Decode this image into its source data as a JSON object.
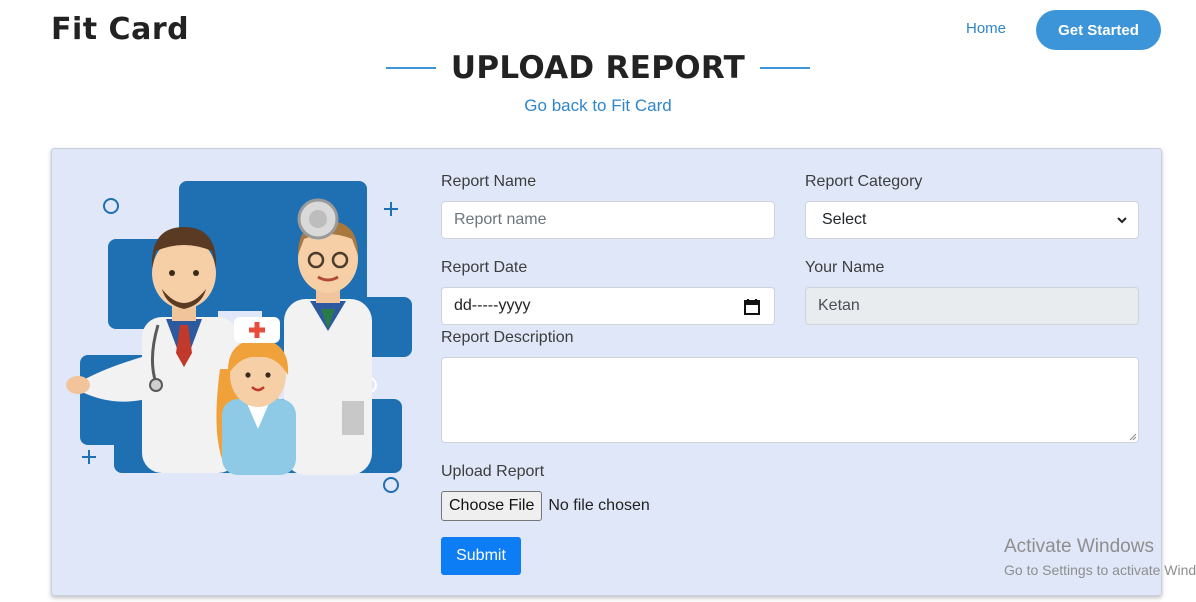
{
  "header": {
    "brand": "Fit Card",
    "nav_home": "Home",
    "get_started": "Get Started"
  },
  "page": {
    "title": "UPLOAD REPORT",
    "back_link": "Go back to Fit Card"
  },
  "form": {
    "report_name_label": "Report Name",
    "report_name_placeholder": "Report name",
    "report_category_label": "Report Category",
    "report_category_value": "Select",
    "report_date_label": "Report Date",
    "report_date_value": "dd-----yyyy",
    "your_name_label": "Your Name",
    "your_name_value": "Ketan",
    "description_label": "Report Description",
    "upload_label": "Upload Report",
    "choose_file": "Choose File",
    "no_file": "No file chosen",
    "submit": "Submit"
  },
  "watermark": {
    "line1": "Activate Windows",
    "line2": "Go to Settings to activate Windows."
  },
  "colors": {
    "accent": "#3b95d8",
    "card_bg": "#dfe7f8",
    "submit_bg": "#0d7df5",
    "illustration_blue": "#1f6fb3"
  }
}
